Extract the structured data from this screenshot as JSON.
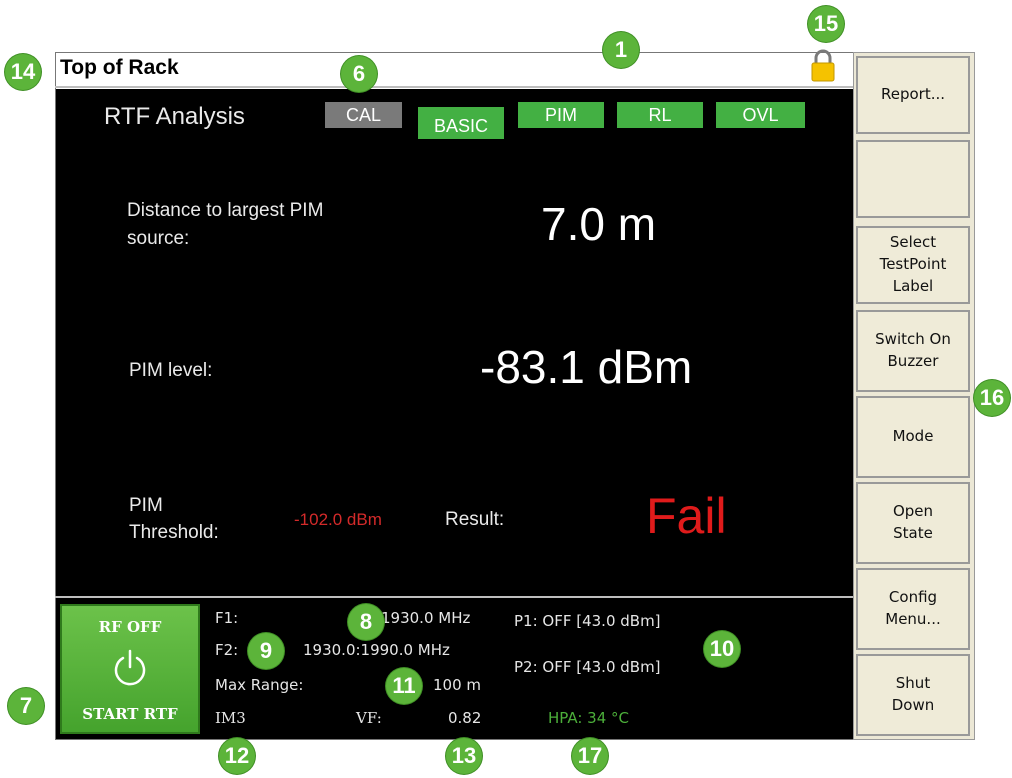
{
  "title_bar": {
    "title": "Top of Rack"
  },
  "analysis": {
    "label": "RTF Analysis"
  },
  "tabs": {
    "cal": "CAL",
    "basic": "BASIC",
    "pim": "PIM",
    "rl": "RL",
    "ovl": "OVL"
  },
  "results": {
    "distance_label_line1": "Distance to largest PIM",
    "distance_label_line2": "source:",
    "distance_value": "7.0 m",
    "pim_level_label": "PIM level:",
    "pim_level_value": "-83.1 dBm",
    "threshold_label_line1": "PIM",
    "threshold_label_line2": "Threshold:",
    "threshold_value": "-102.0 dBm",
    "result_label": "Result:",
    "result_value": "Fail"
  },
  "rf_button": {
    "top_label": "RF OFF",
    "bottom_label": "START RTF"
  },
  "params": {
    "f1_label": "F1:",
    "f1_value": "1930.0 MHz",
    "f2_label": "F2:",
    "f2_value": "1930.0:1990.0  MHz",
    "max_range_label": "Max Range:",
    "max_range_value": "100 m",
    "im_label": "IM3",
    "vf_label": "VF:",
    "vf_value": "0.82",
    "p1": "P1: OFF [43.0 dBm]",
    "p2": "P2: OFF [43.0 dBm]",
    "hpa": "HPA: 34 °C"
  },
  "softkeys": {
    "report": "Report...",
    "select_testpoint": "Select\nTestPoint\nLabel",
    "buzzer": "Switch On\nBuzzer",
    "mode": "Mode",
    "open_state": "Open\nState",
    "config": "Config\nMenu...",
    "shutdown": "Shut\nDown"
  },
  "callouts": [
    "1",
    "6",
    "7",
    "8",
    "9",
    "10",
    "11",
    "12",
    "13",
    "14",
    "15",
    "16",
    "17"
  ],
  "icons": {
    "lock": "lock-icon",
    "power": "power-icon"
  },
  "colors": {
    "accent_green": "#43b043",
    "fail_red": "#e01b1b",
    "threshold_red": "#d42a2a",
    "hpa_green": "#4caf3a"
  }
}
